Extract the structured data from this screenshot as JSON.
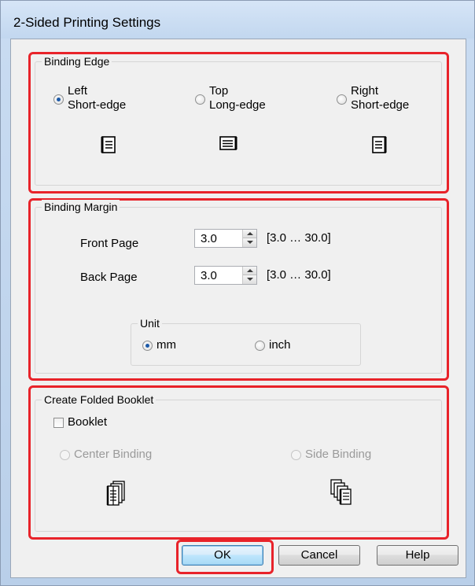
{
  "window": {
    "title": "2-Sided Printing Settings"
  },
  "binding_edge": {
    "legend": "Binding Edge",
    "options": [
      {
        "line1": "Left",
        "line2": "Short-edge",
        "selected": true,
        "icon": "document-left-binding-icon"
      },
      {
        "line1": "Top",
        "line2": "Long-edge",
        "selected": false,
        "icon": "document-top-binding-icon"
      },
      {
        "line1": "Right",
        "line2": "Short-edge",
        "selected": false,
        "icon": "document-right-binding-icon"
      }
    ]
  },
  "binding_margin": {
    "legend": "Binding Margin",
    "front": {
      "label": "Front Page",
      "value": "3.0",
      "range": "[3.0 … 30.0]"
    },
    "back": {
      "label": "Back Page",
      "value": "3.0",
      "range": "[3.0 … 30.0]"
    },
    "unit": {
      "legend": "Unit",
      "options": [
        {
          "label": "mm",
          "selected": true
        },
        {
          "label": "inch",
          "selected": false
        }
      ]
    }
  },
  "booklet": {
    "legend": "Create Folded Booklet",
    "checkbox_label": "Booklet",
    "checked": false,
    "options": [
      {
        "label": "Center Binding",
        "enabled": false,
        "icon": "center-binding-booklet-icon"
      },
      {
        "label": "Side Binding",
        "enabled": false,
        "icon": "side-binding-booklet-icon"
      }
    ]
  },
  "buttons": {
    "ok": "OK",
    "cancel": "Cancel",
    "help": "Help"
  },
  "colors": {
    "highlight": "#e8232a",
    "accent": "#1d5aa8"
  }
}
